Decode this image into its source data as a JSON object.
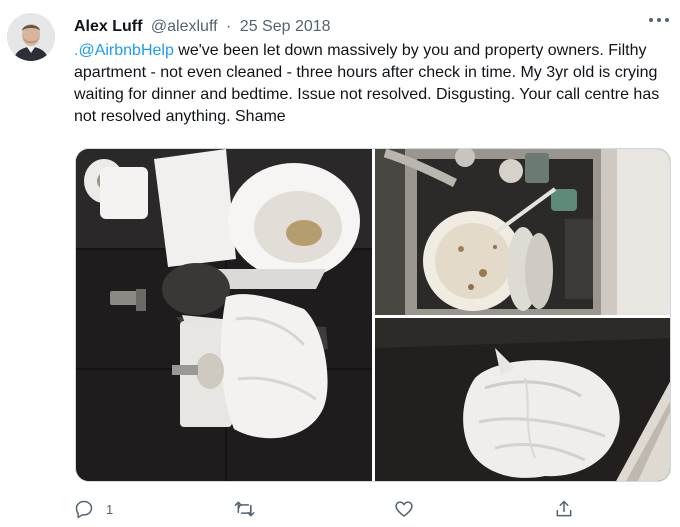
{
  "tweet": {
    "author_name": "Alex Luff",
    "handle": "@alexluff",
    "separator": "·",
    "date": "25 Sep 2018",
    "mention": ".@AirbnbHelp",
    "text": " we've been let down massively by you and property owners. Filthy apartment - not even cleaned - three hours after check in time. My 3yr old is crying waiting for dinner and bedtime. Issue not resolved. Disgusting. Your call centre has not resolved anything. Shame"
  },
  "actions": {
    "reply_count": "1",
    "retweet_count": "",
    "like_count": ""
  },
  "icons": {
    "more": "more-horizontal-icon",
    "reply": "reply-icon",
    "retweet": "retweet-icon",
    "like": "heart-icon",
    "share": "share-icon"
  },
  "colors": {
    "link": "#1d9bf0",
    "secondary_text": "#536471",
    "border": "#cfd9de"
  }
}
